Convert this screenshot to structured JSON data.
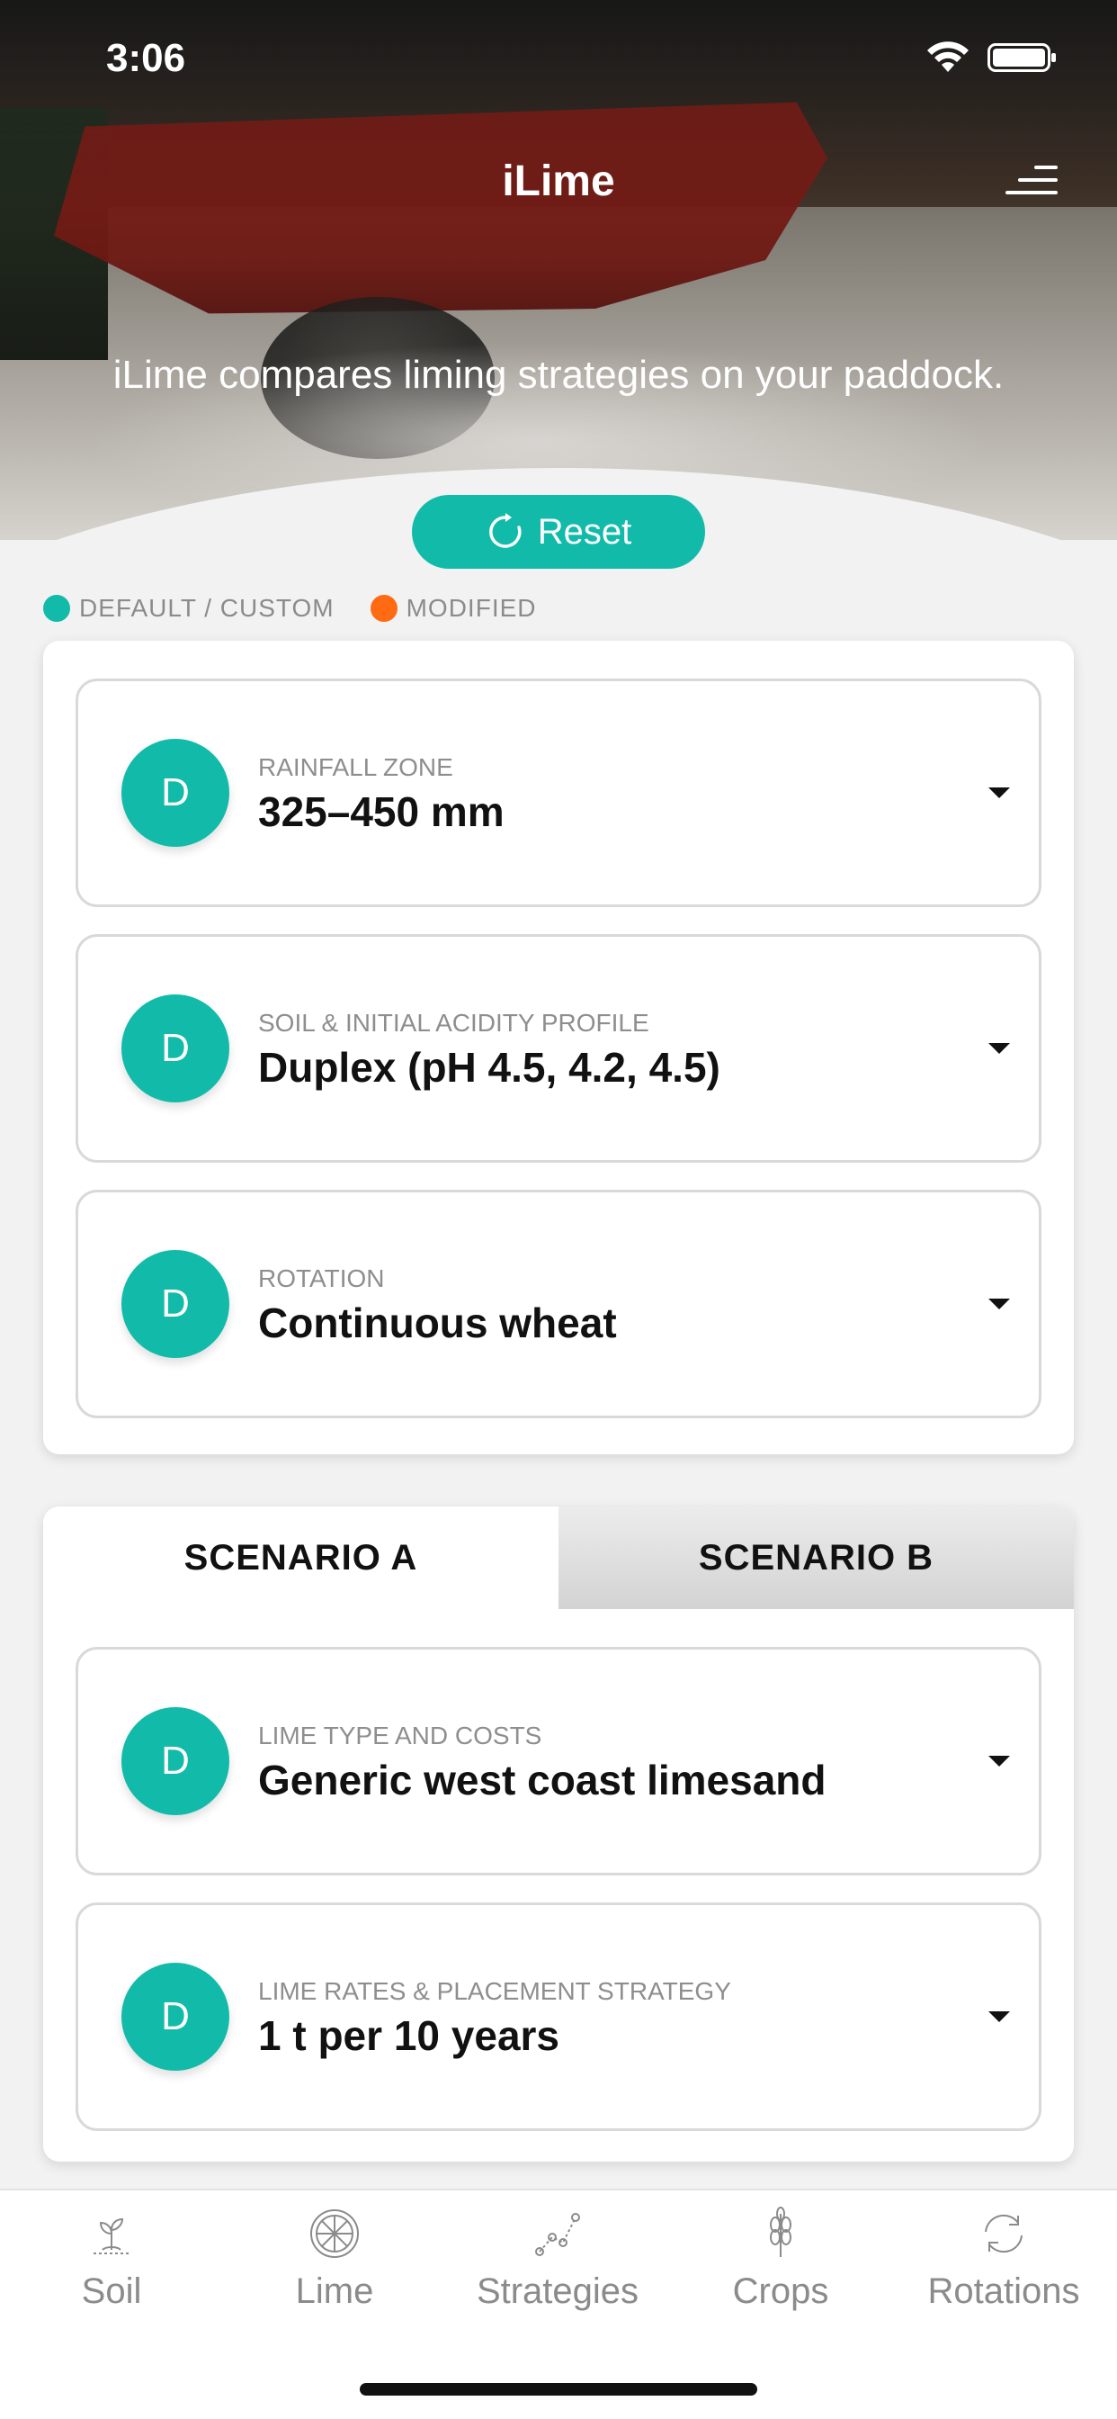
{
  "status_bar": {
    "time": "3:06"
  },
  "header": {
    "title": "iLime",
    "tagline": "iLime compares liming strategies on your paddock."
  },
  "reset_label": "Reset",
  "legend": [
    {
      "label": "DEFAULT / CUSTOM",
      "color": "#12bba9"
    },
    {
      "label": "MODIFIED",
      "color": "#ff6a13"
    }
  ],
  "settings": [
    {
      "badge": "D",
      "label": "RAINFALL ZONE",
      "value": "325–450 mm"
    },
    {
      "badge": "D",
      "label": "SOIL & INITIAL ACIDITY PROFILE",
      "value": "Duplex (pH 4.5, 4.2, 4.5)"
    },
    {
      "badge": "D",
      "label": "ROTATION",
      "value": "Continuous wheat"
    }
  ],
  "scenario_tabs": [
    {
      "label": "SCENARIO A",
      "active": true
    },
    {
      "label": "SCENARIO B",
      "active": false
    }
  ],
  "scenario_settings": [
    {
      "badge": "D",
      "label": "LIME TYPE AND COSTS",
      "value": "Generic west coast limesand"
    },
    {
      "badge": "D",
      "label": "LIME RATES & PLACEMENT STRATEGY",
      "value": "1 t per 10 years"
    }
  ],
  "bottom_nav": [
    {
      "label": "Soil",
      "icon": "soil-icon"
    },
    {
      "label": "Lime",
      "icon": "lime-icon"
    },
    {
      "label": "Strategies",
      "icon": "strategies-icon"
    },
    {
      "label": "Crops",
      "icon": "crops-icon"
    },
    {
      "label": "Rotations",
      "icon": "rotations-icon"
    }
  ],
  "colors": {
    "accent": "#12bba9",
    "modified": "#ff6a13",
    "nav_text": "#8b8b8b"
  }
}
